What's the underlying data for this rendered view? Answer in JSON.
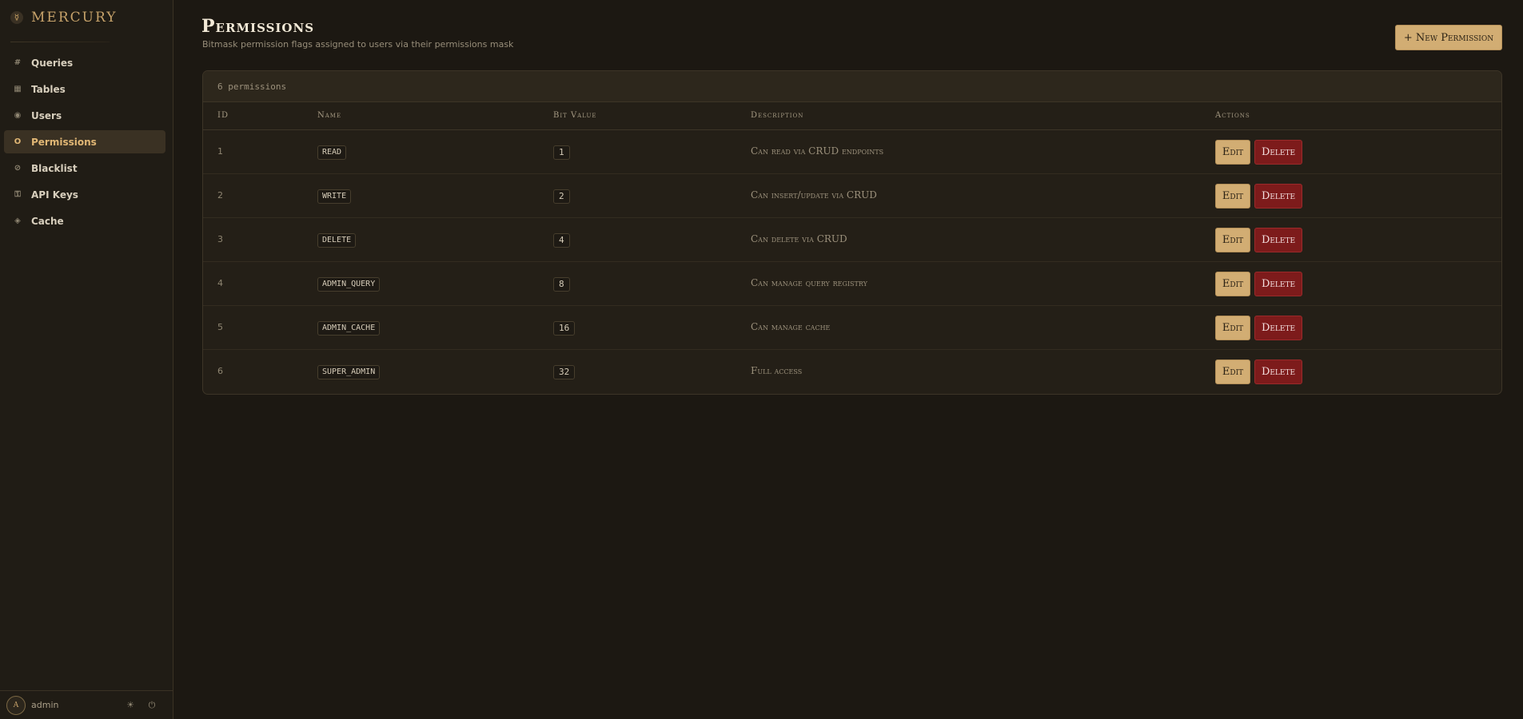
{
  "brand": {
    "logo_glyph": "☿",
    "name": "MERCURY"
  },
  "nav": [
    {
      "label": "Queries",
      "icon": "#",
      "icon_name": "hash-icon",
      "active": false
    },
    {
      "label": "Tables",
      "icon": "▦",
      "icon_name": "table-icon",
      "active": false
    },
    {
      "label": "Users",
      "icon": "◉",
      "icon_name": "users-icon",
      "active": false
    },
    {
      "label": "Permissions",
      "icon": "O",
      "icon_name": "permissions-icon",
      "active": true
    },
    {
      "label": "Blacklist",
      "icon": "⊘",
      "icon_name": "blacklist-icon",
      "active": false
    },
    {
      "label": "API Keys",
      "icon": "⚿",
      "icon_name": "key-icon",
      "active": false
    },
    {
      "label": "Cache",
      "icon": "◈",
      "icon_name": "cache-icon",
      "active": false
    }
  ],
  "user": {
    "avatar_initial": "A",
    "name": "admin",
    "theme_icon": "☀",
    "logout_icon": "⏻"
  },
  "page": {
    "title": "Permissions",
    "subtitle": "Bitmask permission flags assigned to users via their permissions mask",
    "new_button": "+ New Permission"
  },
  "table": {
    "count_label": "6 permissions",
    "headers": {
      "id": "ID",
      "name": "Name",
      "bit": "Bit Value",
      "desc": "Description",
      "actions": "Actions"
    },
    "edit_label": "Edit",
    "delete_label": "Delete",
    "rows": [
      {
        "id": "1",
        "name": "READ",
        "bit": "1",
        "desc": "Can read via CRUD endpoints"
      },
      {
        "id": "2",
        "name": "WRITE",
        "bit": "2",
        "desc": "Can insert/update via CRUD"
      },
      {
        "id": "3",
        "name": "DELETE",
        "bit": "4",
        "desc": "Can delete via CRUD"
      },
      {
        "id": "4",
        "name": "ADMIN_QUERY",
        "bit": "8",
        "desc": "Can manage query registry"
      },
      {
        "id": "5",
        "name": "ADMIN_CACHE",
        "bit": "16",
        "desc": "Can manage cache"
      },
      {
        "id": "6",
        "name": "SUPER_ADMIN",
        "bit": "32",
        "desc": "Full access"
      }
    ]
  },
  "colors": {
    "background": "#1c1812",
    "accent": "#d2ad73",
    "danger": "#7d1b1b",
    "active_nav": "#3a3123"
  }
}
